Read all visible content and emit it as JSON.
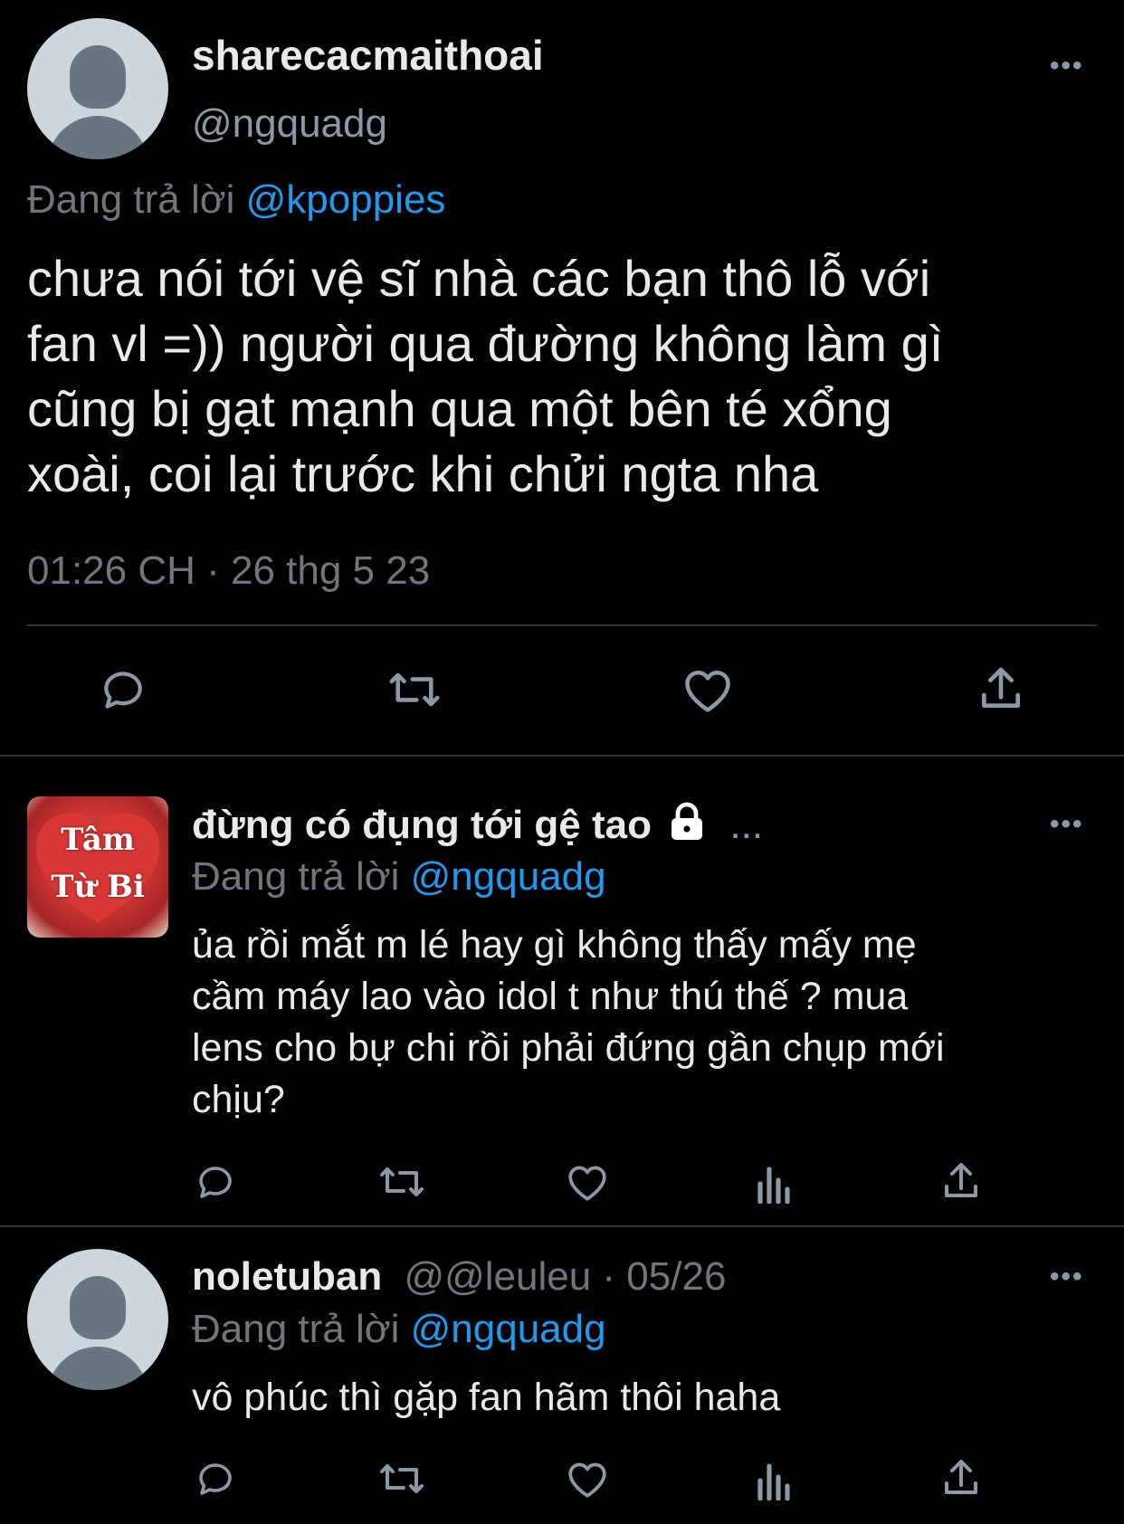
{
  "main_tweet": {
    "display_name": "sharecacmaithoai",
    "handle": "@ngquadg",
    "reply_prefix": "Đang trả lời",
    "reply_to": "@kpoppies",
    "text_lines": [
      "chưa nói tới vệ sĩ nhà các bạn thô lỗ với",
      "fan vl =)) người qua đường không làm gì",
      "cũng bị gạt mạnh qua một bên té xổng",
      "xoài, coi lại trước khi chửi ngta nha"
    ],
    "timestamp": "01:26 CH · 26 thg 5 23",
    "more": "•••"
  },
  "reply1": {
    "display_name": "đừng có đụng tới gệ tao",
    "trailing": "...",
    "avatar_text_1": "Tâm",
    "avatar_text_2": "Từ Bi",
    "reply_prefix": "Đang trả lời",
    "reply_to": "@ngquadg",
    "text_lines": [
      "ủa rồi mắt m lé hay gì không thấy mấy mẹ",
      "cầm máy lao vào idol t như thú thế ? mua",
      "lens cho bự chi rồi phải đứng gần chụp mới",
      "chịu?"
    ],
    "more": "•••"
  },
  "reply2": {
    "display_name": "noletuban",
    "handle_date": "@@leuleu · 05/26",
    "reply_prefix": "Đang trả lời",
    "reply_to": "@ngquadg",
    "text": "vô phúc thì gặp fan hãm thôi haha",
    "more": "•••"
  },
  "icons": {
    "reply": "reply-icon",
    "retweet": "retweet-icon",
    "like": "like-icon",
    "share": "share-icon",
    "analytics": "analytics-icon",
    "lock": "lock-icon"
  },
  "colors": {
    "background": "#000000",
    "text": "#e7e9ea",
    "muted": "#71767b",
    "link": "#1d9bf0",
    "divider": "#2f3336"
  }
}
